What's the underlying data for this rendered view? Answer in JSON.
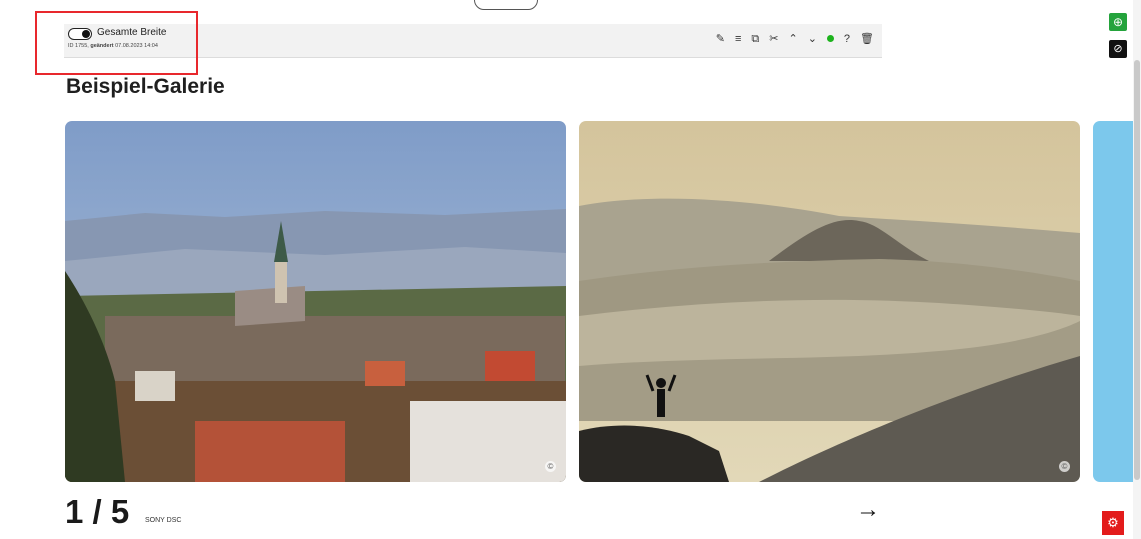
{
  "block": {
    "toggle_label": "Gesamte Breite",
    "meta_prefix": "ID 1755,",
    "meta_changed": "geändert",
    "meta_date": "07.08.2023 14:04",
    "toolbar_icons": [
      "edit-icon",
      "insert-after-icon",
      "copy-icon",
      "cut-icon",
      "move-up-icon",
      "move-down-icon",
      "status-online-icon",
      "help-icon",
      "delete-icon"
    ]
  },
  "gallery": {
    "title": "Beispiel-Galerie",
    "counter": "1 / 5",
    "caption": "SONY DSC",
    "next_label": "→",
    "copyright_symbol": "©"
  },
  "side_buttons": {
    "add": "⊕",
    "hide": "⊘",
    "settings": "⚙"
  },
  "colors": {
    "highlight": "#e8282d",
    "add_button": "#24a33c",
    "status_dot": "#1db31d",
    "settings_button": "#e31b1b"
  }
}
